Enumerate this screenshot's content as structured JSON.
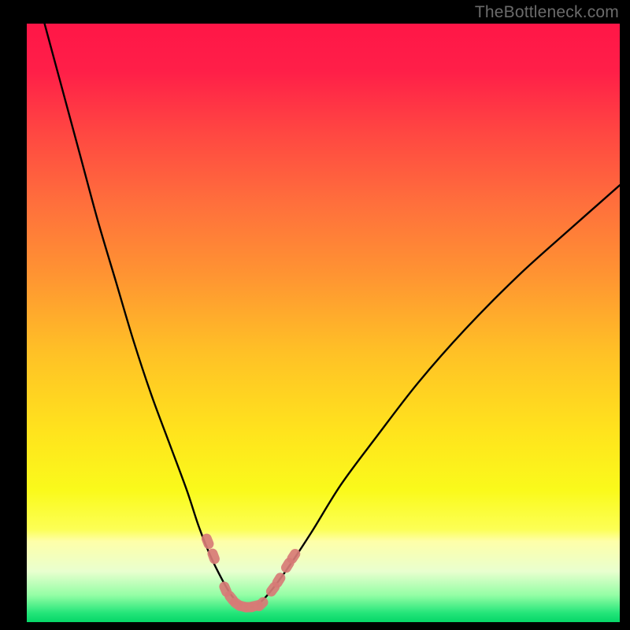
{
  "watermark": "TheBottleneck.com",
  "gradient": {
    "stops": [
      {
        "offset": 0.0,
        "color": "#ff1647"
      },
      {
        "offset": 0.08,
        "color": "#ff1f48"
      },
      {
        "offset": 0.18,
        "color": "#ff4642"
      },
      {
        "offset": 0.3,
        "color": "#ff6f3c"
      },
      {
        "offset": 0.42,
        "color": "#ff9432"
      },
      {
        "offset": 0.55,
        "color": "#ffc126"
      },
      {
        "offset": 0.68,
        "color": "#ffe31d"
      },
      {
        "offset": 0.78,
        "color": "#fafa1b"
      },
      {
        "offset": 0.845,
        "color": "#fcff55"
      },
      {
        "offset": 0.865,
        "color": "#feffa9"
      },
      {
        "offset": 0.915,
        "color": "#e9ffcf"
      },
      {
        "offset": 0.955,
        "color": "#94fea5"
      },
      {
        "offset": 0.985,
        "color": "#23e579"
      },
      {
        "offset": 1.0,
        "color": "#06d668"
      }
    ]
  },
  "chart_data": {
    "type": "line",
    "title": "",
    "xlabel": "",
    "ylabel": "",
    "xlim": [
      0,
      100
    ],
    "ylim": [
      0,
      100
    ],
    "series": [
      {
        "name": "bottleneck-curve",
        "x": [
          3,
          6,
          9,
          12,
          15,
          18,
          21,
          24,
          27,
          29,
          31,
          33,
          34.5,
          36,
          37.5,
          39,
          41,
          44,
          48,
          53,
          59,
          66,
          74,
          83,
          92,
          100
        ],
        "y": [
          100,
          89,
          78,
          67,
          57,
          47,
          38,
          30,
          22,
          16,
          11,
          7,
          4.5,
          3,
          2.5,
          3,
          5,
          9,
          15,
          23,
          31,
          40,
          49,
          58,
          66,
          73
        ]
      }
    ],
    "annotations": {
      "optimum_x": 37,
      "marker_points": [
        {
          "x": 30.5,
          "y": 13.5
        },
        {
          "x": 31.5,
          "y": 11.0
        },
        {
          "x": 33.5,
          "y": 5.5
        },
        {
          "x": 34.5,
          "y": 4.0
        },
        {
          "x": 35.5,
          "y": 3.0
        },
        {
          "x": 36.5,
          "y": 2.6
        },
        {
          "x": 37.5,
          "y": 2.5
        },
        {
          "x": 38.5,
          "y": 2.7
        },
        {
          "x": 39.5,
          "y": 3.0
        },
        {
          "x": 41.5,
          "y": 5.5
        },
        {
          "x": 42.5,
          "y": 7.0
        },
        {
          "x": 44.0,
          "y": 9.5
        },
        {
          "x": 45.0,
          "y": 11.0
        }
      ]
    }
  }
}
